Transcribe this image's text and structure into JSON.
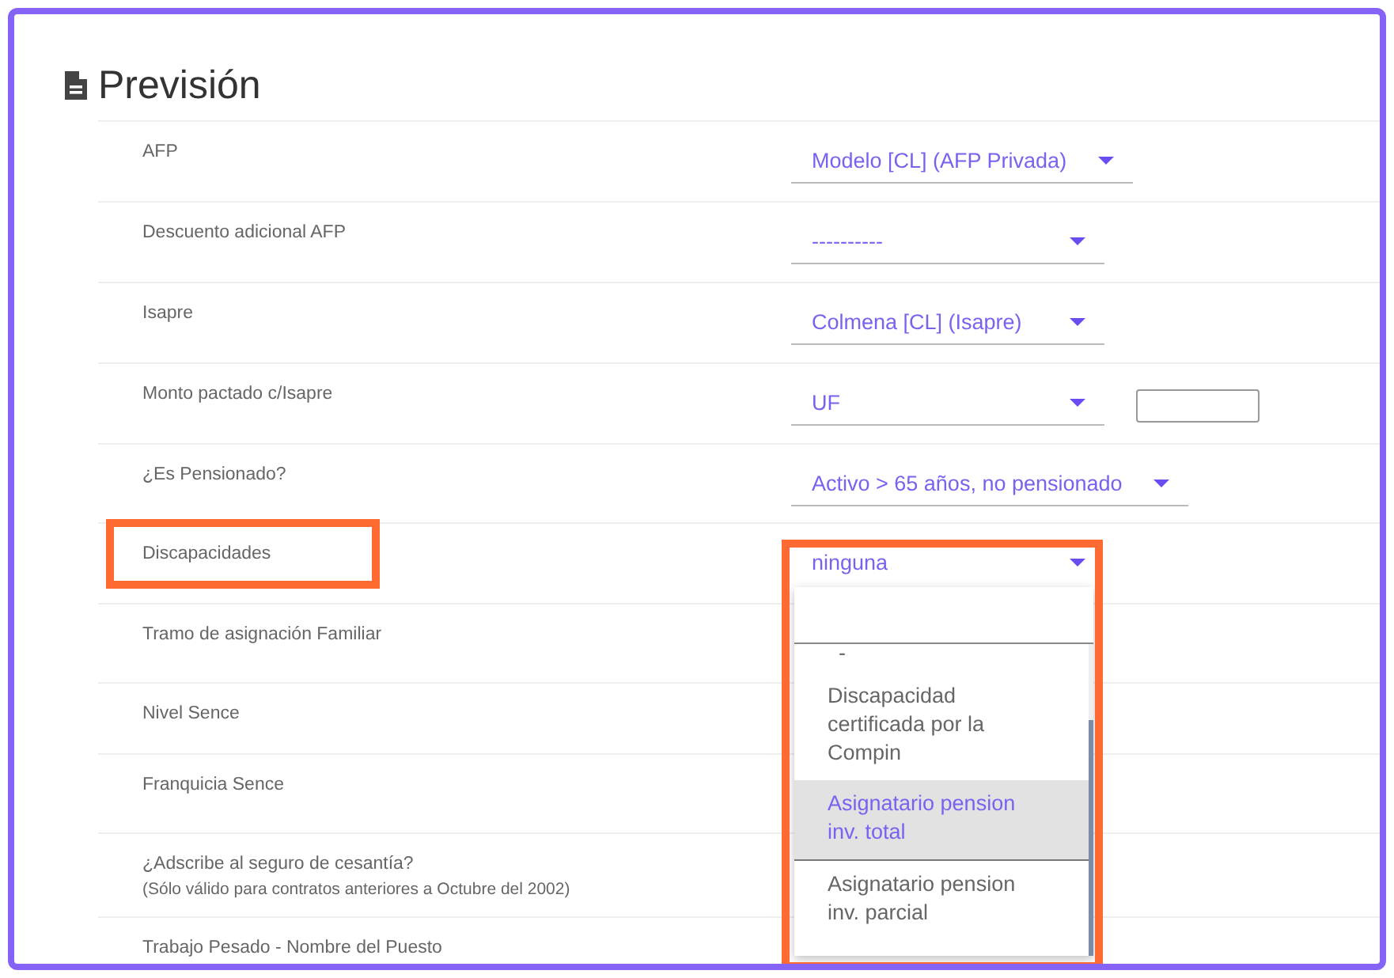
{
  "section": {
    "title": "Previsión"
  },
  "rows": [
    {
      "label": "AFP",
      "kind": "select",
      "value": "Modelo [CL] (AFP Privada)",
      "expanded": false,
      "annotated": false
    },
    {
      "label": "Descuento adicional AFP",
      "kind": "select",
      "value": "----------",
      "expanded": false,
      "annotated": false
    },
    {
      "label": "Isapre",
      "kind": "select",
      "value": "Colmena [CL] (Isapre)",
      "expanded": false,
      "annotated": false
    },
    {
      "label": "Monto pactado c/Isapre",
      "kind": "select_input",
      "value": "UF",
      "expanded": false,
      "annotated": false
    },
    {
      "label": "¿Es Pensionado?",
      "kind": "select",
      "value": "Activo > 65 años, no pensionado",
      "expanded": false,
      "annotated": false
    },
    {
      "label": "Discapacidades",
      "kind": "select",
      "value": "ninguna",
      "expanded": true,
      "annotated": true
    },
    {
      "label": "Tramo de asignación Familiar",
      "kind": "empty",
      "annotated": false
    },
    {
      "label": "Nivel Sence",
      "kind": "empty",
      "annotated": false
    },
    {
      "label": "Franquicia Sence",
      "kind": "empty",
      "annotated": false
    },
    {
      "label": "¿Adscribe al seguro de cesantía?",
      "note": "(Sólo válido para contratos anteriores a Octubre del 2002)",
      "kind": "empty",
      "annotated": false
    },
    {
      "label": "Trabajo Pesado - Nombre del Puesto",
      "kind": "empty",
      "annotated": false
    }
  ],
  "dropdown": {
    "annotated": true,
    "options": [
      {
        "label": "-",
        "selected": false
      },
      {
        "label": "Discapacidad certificada por la Compin",
        "selected": false
      },
      {
        "label": "Asignatario pension inv. total",
        "selected": true
      },
      {
        "label": "Asignatario pension inv. parcial",
        "selected": false
      }
    ]
  }
}
